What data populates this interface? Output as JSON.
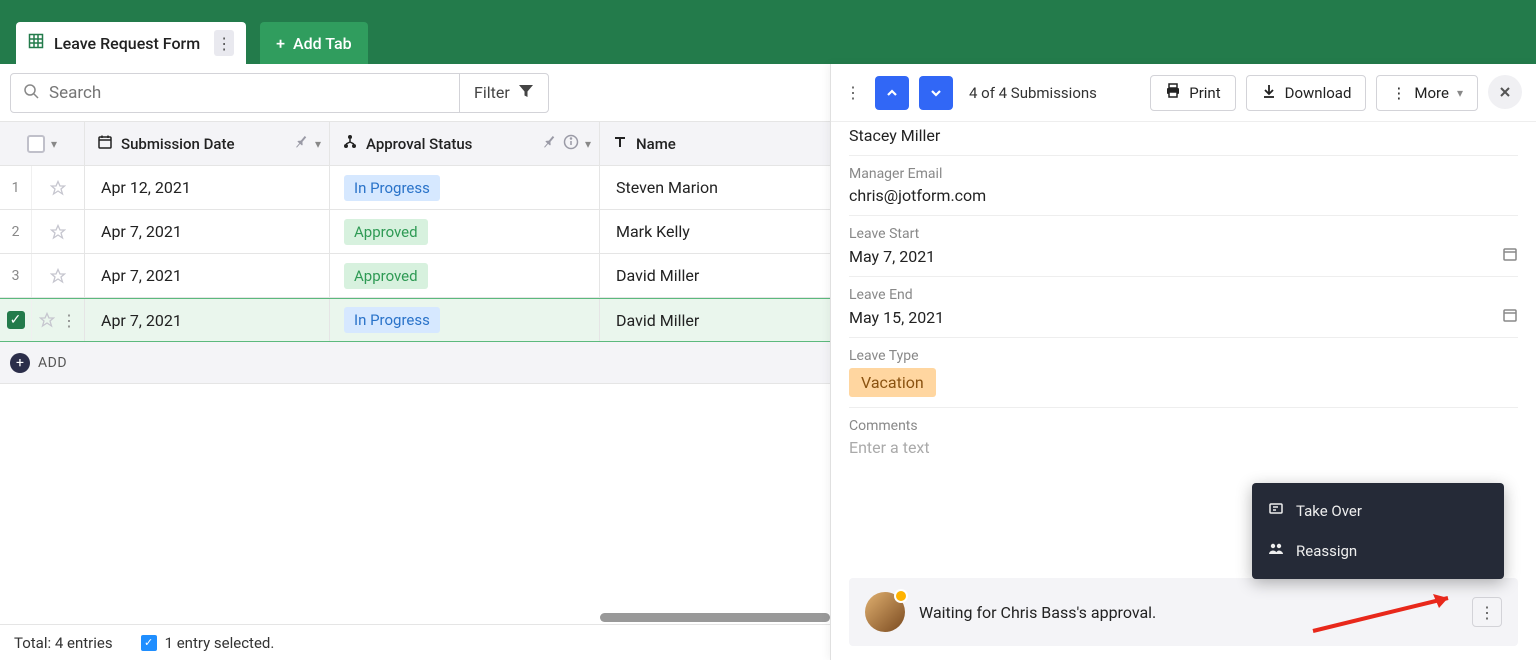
{
  "tabs": {
    "active_label": "Leave Request Form",
    "add_label": "Add Tab"
  },
  "toolbar": {
    "search_placeholder": "Search",
    "filter_label": "Filter"
  },
  "columns": {
    "submission_date": "Submission Date",
    "approval_status": "Approval Status",
    "name": "Name"
  },
  "rows": [
    {
      "num": "1",
      "date": "Apr 12, 2021",
      "status": "In Progress",
      "status_kind": "progress",
      "name": "Steven Marion",
      "selected": false
    },
    {
      "num": "2",
      "date": "Apr 7, 2021",
      "status": "Approved",
      "status_kind": "approved",
      "name": "Mark Kelly",
      "selected": false
    },
    {
      "num": "3",
      "date": "Apr 7, 2021",
      "status": "Approved",
      "status_kind": "approved",
      "name": "David Miller",
      "selected": false
    },
    {
      "num": "",
      "date": "Apr 7, 2021",
      "status": "In Progress",
      "status_kind": "progress",
      "name": "David Miller",
      "selected": true
    }
  ],
  "add_row_label": "ADD",
  "status_bar": {
    "total": "Total: 4 entries",
    "selected": "1 entry selected."
  },
  "detail": {
    "pager_text": "4 of 4 Submissions",
    "print": "Print",
    "download": "Download",
    "more": "More",
    "fields": {
      "name_value": "Stacey Miller",
      "manager_email_label": "Manager Email",
      "manager_email_value": "chris@jotform.com",
      "leave_start_label": "Leave Start",
      "leave_start_value": "May 7, 2021",
      "leave_end_label": "Leave End",
      "leave_end_value": "May 15, 2021",
      "leave_type_label": "Leave Type",
      "leave_type_value": "Vacation",
      "comments_label": "Comments",
      "comments_placeholder": "Enter a text"
    },
    "approval_text": "Waiting for Chris Bass's approval.",
    "popover": {
      "take_over": "Take Over",
      "reassign": "Reassign"
    }
  }
}
